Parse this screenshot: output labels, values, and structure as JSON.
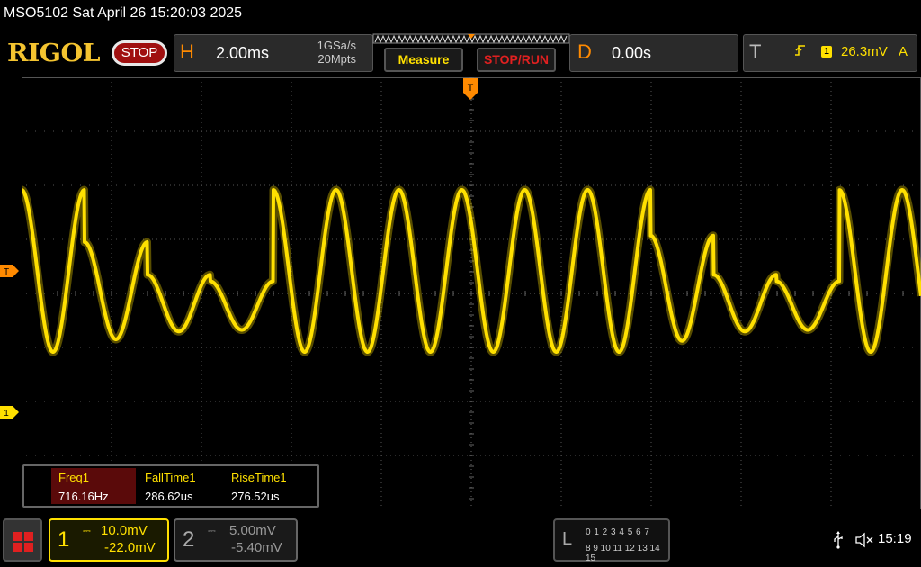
{
  "title_bar": {
    "text": "MSO5102  Sat April 26 15:20:03 2025"
  },
  "toolbar": {
    "logo": "RIGOL",
    "run_state": "STOP",
    "horizontal": {
      "letter": "H",
      "timebase": "2.00ms",
      "sample_rate": "1GSa/s",
      "memory_depth": "20Mpts"
    },
    "measure_label": "Measure",
    "stop_run_label": "STOP/RUN",
    "delay": {
      "letter": "D",
      "value": "0.00s"
    },
    "trigger": {
      "letter": "T",
      "source": "1",
      "level": "26.3mV",
      "mode": "A",
      "slope_icon": "rising-edge-icon"
    }
  },
  "screen": {
    "trigger_marker": "T",
    "ch1_marker": "1",
    "trigger_pos_marker": "T"
  },
  "measurements": [
    {
      "name": "Freq1",
      "value": "716.16Hz"
    },
    {
      "name": "FallTime1",
      "value": "286.62us"
    },
    {
      "name": "RiseTime1",
      "value": "276.52us"
    }
  ],
  "channels": {
    "ch1": {
      "label": "1",
      "scale": "10.0mV",
      "offset": "-22.0mV",
      "color": "#ffe000"
    },
    "ch2": {
      "label": "2",
      "scale": "5.00mV",
      "offset": "-5.40mV",
      "color": "#999999"
    }
  },
  "logic": {
    "letter": "L",
    "row1": "0 1 2 3   4 5 6 7",
    "row2": "8  9 10 11  12 13 14 15"
  },
  "status": {
    "clock": "15:19",
    "usb_icon": "usb-icon",
    "mute_icon": "speaker-mute-icon"
  },
  "colors": {
    "trace": "#ffe000",
    "accent": "#ff8a00",
    "stop": "#a01010"
  },
  "waveform": {
    "carrier_periods_on_screen": 14.3,
    "amplitude_levels": [
      1.0,
      0.6,
      0.35,
      0.3,
      1.0,
      1.0,
      1.0,
      1.0,
      1.0,
      1.0,
      0.65,
      0.35,
      0.3,
      1.0
    ]
  }
}
